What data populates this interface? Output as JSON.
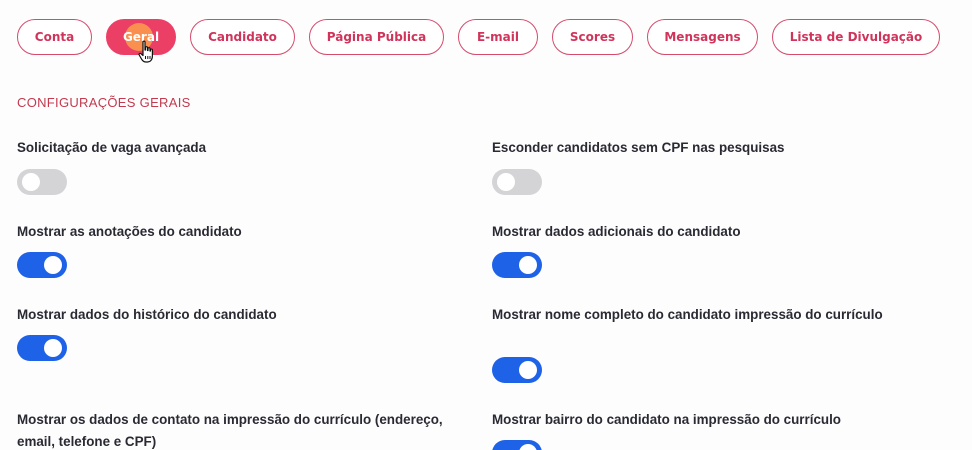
{
  "tabs": [
    {
      "label": "Conta",
      "active": false
    },
    {
      "label": "Geral",
      "active": true
    },
    {
      "label": "Candidato",
      "active": false
    },
    {
      "label": "Página Pública",
      "active": false
    },
    {
      "label": "E-mail",
      "active": false
    },
    {
      "label": "Scores",
      "active": false
    },
    {
      "label": "Mensagens",
      "active": false
    },
    {
      "label": "Lista de Divulgação",
      "active": false
    }
  ],
  "section": {
    "title": "CONFIGURAÇÕES GERAIS"
  },
  "settings": [
    {
      "label": "Solicitação de vaga avançada",
      "enabled": false
    },
    {
      "label": "Esconder candidatos sem CPF nas pesquisas",
      "enabled": false
    },
    {
      "label": "Mostrar as anotações do candidato",
      "enabled": true
    },
    {
      "label": "Mostrar dados adicionais do candidato",
      "enabled": true
    },
    {
      "label": "Mostrar dados do histórico do candidato",
      "enabled": true
    },
    {
      "label": "Mostrar nome completo do candidato impressão do currículo",
      "enabled": true
    },
    {
      "label": "Mostrar os dados de contato na impressão do currículo (endereço, email, telefone e CPF)",
      "enabled": true
    },
    {
      "label": "Mostrar bairro do candidato na impressão do currículo",
      "enabled": true
    }
  ],
  "colors": {
    "accent": "#ec3f66",
    "tab_border": "#d64a6c",
    "toggle_on": "#1e62e8",
    "toggle_off": "#d4d4d6",
    "section_title": "#c23a4e"
  }
}
